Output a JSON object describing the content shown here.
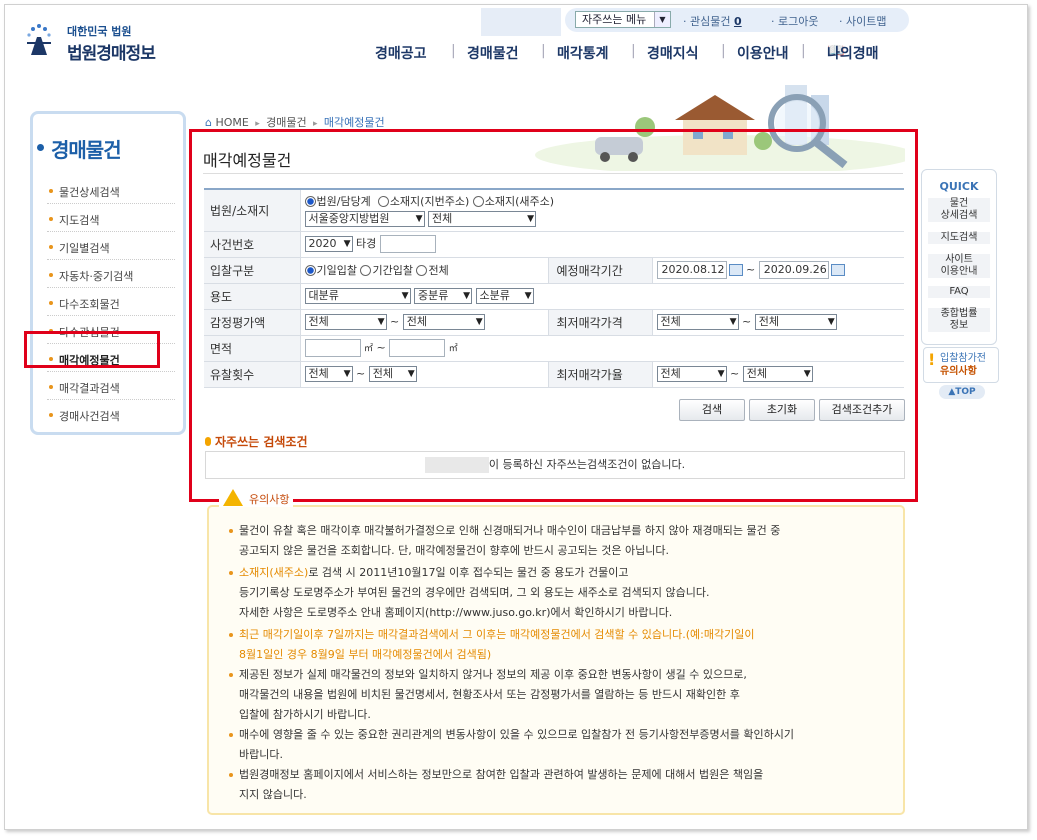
{
  "header": {
    "logo_small": "대한민국 법원",
    "logo_big": "법원경매정보",
    "quick_menu_select": "자주쓰는 메뉴",
    "util_links": [
      "관심물건",
      "로그아웃",
      "사이트맵"
    ],
    "interest_count": "0",
    "nav": [
      "경매공고",
      "경매물건",
      "매각통계",
      "경매지식",
      "이용안내",
      "나의경매"
    ]
  },
  "sidebar": {
    "title": "경매물건",
    "items": [
      {
        "label": "물건상세검색"
      },
      {
        "label": "지도검색"
      },
      {
        "label": "기일별검색"
      },
      {
        "label": "자동차·중기검색"
      },
      {
        "label": "다수조회물건"
      },
      {
        "label": "다수관심물건"
      },
      {
        "label": "매각예정물건"
      },
      {
        "label": "매각결과검색"
      },
      {
        "label": "경매사건검색"
      }
    ]
  },
  "breadcrumb": {
    "home": "HOME",
    "level1": "경매물건",
    "current": "매각예정물건"
  },
  "page_title": "매각예정물건",
  "form": {
    "court_label": "법원/소재지",
    "court_radios": [
      "법원/담당계",
      "소재지(지번주소)",
      "소재지(새주소)"
    ],
    "court_select": "서울중앙지방법원",
    "dept_select": "전체",
    "case_label": "사건번호",
    "case_year": "2020",
    "case_type": "타경",
    "bid_label": "입찰구분",
    "bid_radios": [
      "기일입찰",
      "기간입찰",
      "전체"
    ],
    "sale_period_label": "예정매각기간",
    "date_from": "2020.08.12",
    "date_to": "2020.09.26",
    "use_label": "용도",
    "use_large": "대분류",
    "use_mid": "중분류",
    "use_small": "소분류",
    "appraisal_label": "감정평가액",
    "appraisal_from": "전체",
    "appraisal_to": "전체",
    "min_price_label": "최저매각가격",
    "min_price_from": "전체",
    "min_price_to": "전체",
    "area_label": "면적",
    "area_unit": "㎡",
    "fail_label": "유찰횟수",
    "fail_from": "전체",
    "fail_to": "전체",
    "min_rate_label": "최저매각가율",
    "min_rate_from": "전체",
    "min_rate_to": "전체",
    "tilde": "~",
    "btn_search": "검색",
    "btn_reset": "초기화",
    "btn_add": "검색조건추가"
  },
  "favorites": {
    "title": "자주쓰는 검색조건",
    "empty_text": "이 등록하신 자주쓰는검색조건이 없습니다."
  },
  "notice": {
    "title": "유의사항",
    "lines": [
      "물건이 유찰 혹은 매각이후 매각불허가결정으로 인해 신경매되거나 매수인이 대금납부를 하지 않아 재경매되는 물건 중",
      "공고되지 않은 물건을 조회합니다. 단, 매각예정물건이 향후에 반드시 공고되는 것은 아닙니다.",
      "소재지(새주소)",
      "로 검색 시 2011년10월17일 이후 접수되는 물건 중 용도가 건물이고",
      "등기기록상 도로명주소가 부여된 물건의 경우에만 검색되며, 그 외 용도는 새주소로 검색되지 않습니다.",
      "자세한 사항은 도로명주소 안내 홈페이지(http://www.juso.go.kr)에서 확인하시기 바랍니다.",
      "최근 매각기일이후 7일까지는 매각결과검색에서 그 이후는 매각예정물건에서 검색할 수 있습니다.(예:매각기일이",
      "8월1일인 경우 8월9일 부터 매각예정물건에서 검색됨)",
      "제공된 정보가 실제 매각물건의 정보와 일치하지 않거나 정보의 제공 이후 중요한 변동사항이 생길 수 있으므로,",
      "매각물건의 내용을 법원에 비치된 물건명세서, 현황조사서 또는 감정평가서를 열람하는 등 반드시 재확인한 후",
      "입찰에 참가하시기 바랍니다.",
      "매수에 영향을 줄 수 있는 중요한 권리관계의 변동사항이 있을 수 있으므로 입찰참가 전 등기사항전부증명서를 확인하시기",
      "바랍니다.",
      "법원경매정보 홈페이지에서 서비스하는 정보만으로 참여한 입찰과 관련하여 발생하는 문제에 대해서 법원은 책임을",
      "지지 않습니다."
    ]
  },
  "quick": {
    "title": "QUICK",
    "items": [
      "물건\n상세검색",
      "지도검색",
      "사이트\n이용안내",
      "FAQ",
      "종합법률\n정보"
    ],
    "warn_line1": "입찰참가전",
    "warn_line2": "유의사항",
    "top": "TOP"
  },
  "colors": {
    "brand_blue": "#1c5fa8",
    "accent_orange": "#e48a00",
    "highlight_red": "#e0001a"
  }
}
